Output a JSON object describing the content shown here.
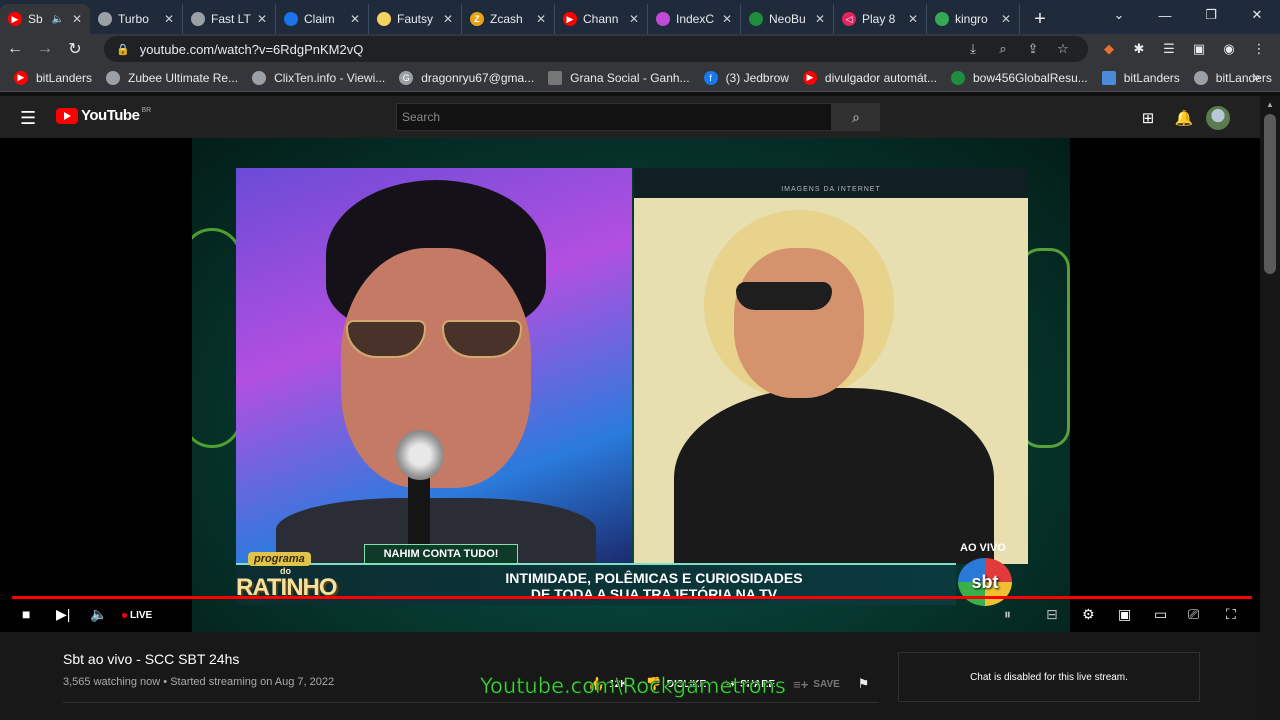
{
  "browser": {
    "tabs": [
      {
        "label": "Sb",
        "fav_color": "#ff0000",
        "active": true
      },
      {
        "label": "Turbo",
        "fav_color": "#9aa0a6"
      },
      {
        "label": "Fast LT",
        "fav_color": "#9aa0a6"
      },
      {
        "label": "Claim",
        "fav_color": "#1a73e8"
      },
      {
        "label": "Fautsy",
        "fav_color": "#f4d35e"
      },
      {
        "label": "Zcash",
        "fav_color": "#e8a317"
      },
      {
        "label": "Chann",
        "fav_color": "#ff0000"
      },
      {
        "label": "IndexC",
        "fav_color": "#c04ad8"
      },
      {
        "label": "NeoBu",
        "fav_color": "#1e8e3e"
      },
      {
        "label": "Play 8",
        "fav_color": "#e0245e"
      },
      {
        "label": "kingro",
        "fav_color": "#34a853"
      }
    ],
    "new_tab_label": "+",
    "window_controls": [
      "⌄",
      "—",
      "❐",
      "✕"
    ],
    "url": "youtube.com/watch?v=6RdgPnKM2vQ",
    "bookmarks": [
      {
        "label": "bitLanders",
        "color": "#ff0000"
      },
      {
        "label": "Zubee Ultimate Re...",
        "color": "#9aa0a6"
      },
      {
        "label": "ClixTen.info - Viewi...",
        "color": "#9aa0a6"
      },
      {
        "label": "dragonryu67@gma...",
        "color": "#9aa0a6"
      },
      {
        "label": "Grana Social - Ganh...",
        "color": "#777777"
      },
      {
        "label": "(3) Jedbrow",
        "color": "#1877f2"
      },
      {
        "label": "divulgador automát...",
        "color": "#ff0000"
      },
      {
        "label": "bow456GlobalResu...",
        "color": "#1e8e3e"
      },
      {
        "label": "bitLanders",
        "color": "#4a8ad8"
      },
      {
        "label": "bitLanders",
        "color": "#9aa0a6"
      }
    ],
    "bookmarks_more": "»"
  },
  "youtube": {
    "logo_text": "YouTube",
    "country_code": "BR",
    "search_placeholder": "Search",
    "video": {
      "overlay_caption": "IMAGENS DA INTERNET",
      "tag": "NAHIM CONTA TUDO!",
      "headline_1": "INTIMIDADE, POLÊMICAS E CURIOSIDADES",
      "headline_2": "DE TODA A SUA TRAJETÓRIA NA TV",
      "program_word_1": "programa",
      "program_word_2": "do",
      "program_word_3": "RATINHO",
      "live_bug": "AO VIVO",
      "channel_bug": "sbt",
      "live_label": "LIVE"
    },
    "title": "Sbt ao vivo - SCC SBT 24hs",
    "meta": "3,565 watching now • Started streaming on Aug 7, 2022",
    "actions": {
      "like_count": "12K",
      "dislike": "DISLIKE",
      "share": "SHARE",
      "save": "SAVE"
    },
    "chat_disabled": "Chat is disabled for this live stream."
  },
  "watermark": "Youtube.com\\Rockgametrons"
}
